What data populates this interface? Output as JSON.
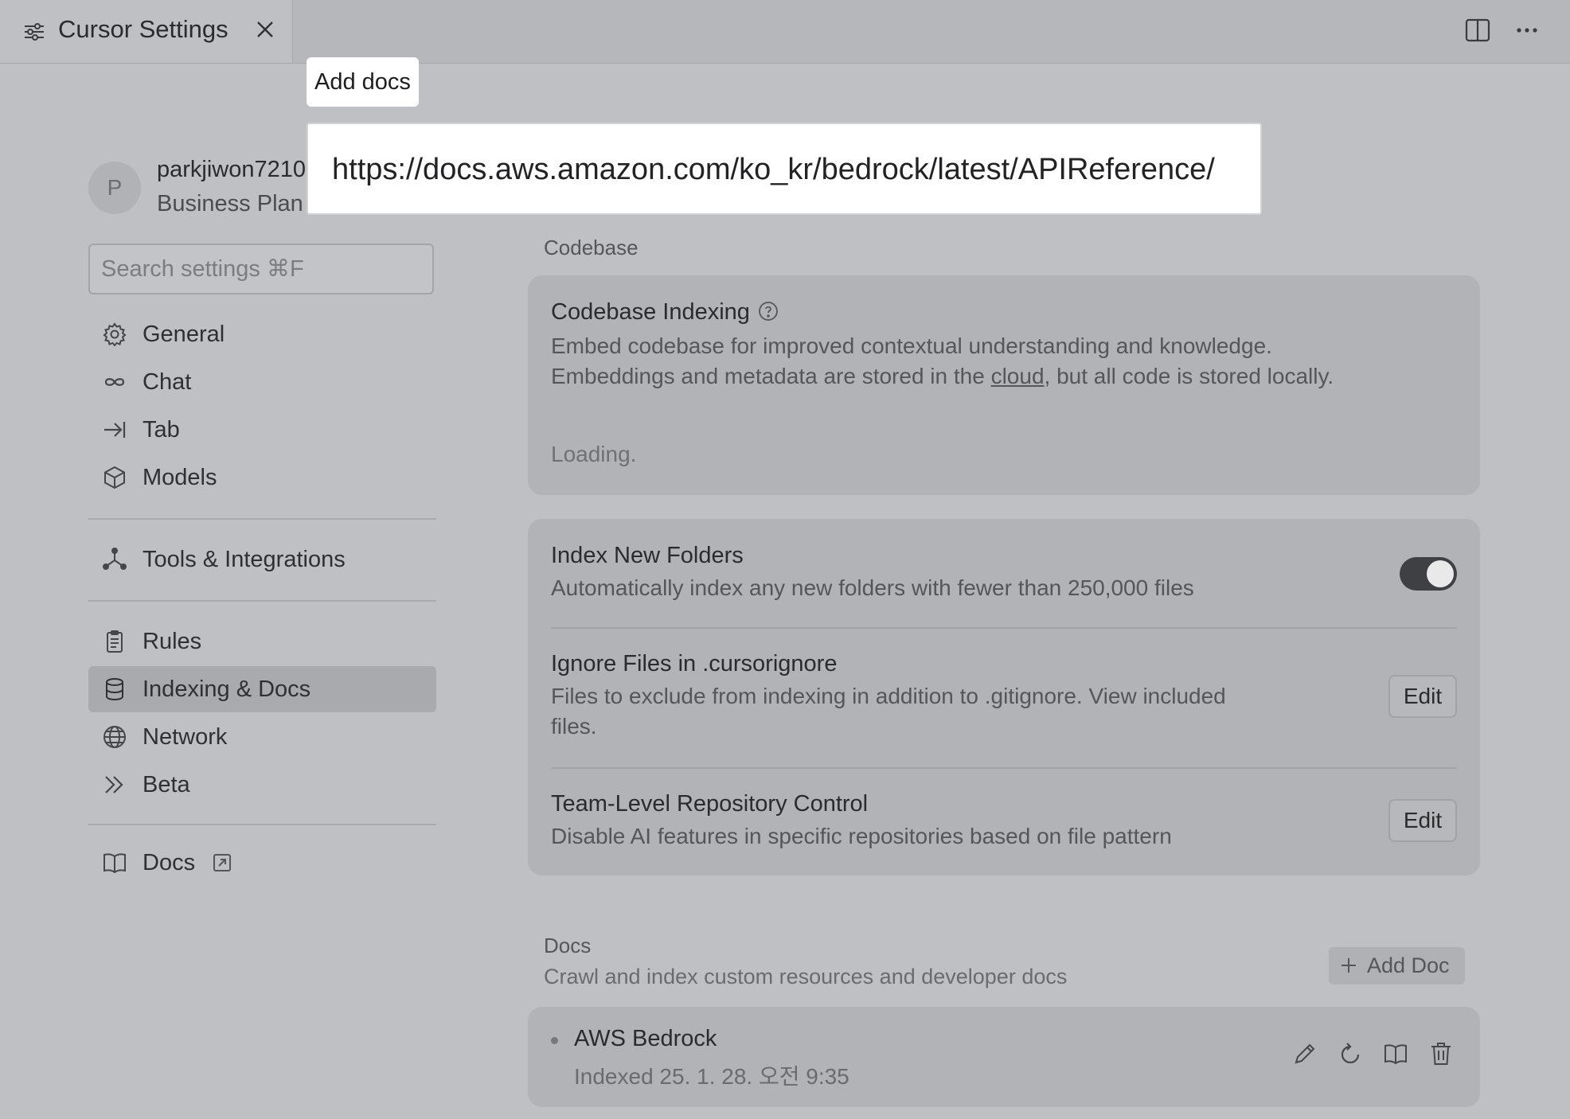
{
  "tab": {
    "title": "Cursor Settings"
  },
  "account": {
    "avatar_letter": "P",
    "username": "parkjiwon7210",
    "plan": "Business Plan"
  },
  "search": {
    "placeholder": "Search settings ⌘F"
  },
  "nav": {
    "general": "General",
    "chat": "Chat",
    "tab": "Tab",
    "models": "Models",
    "tools": "Tools & Integrations",
    "rules": "Rules",
    "indexing": "Indexing & Docs",
    "network": "Network",
    "beta": "Beta",
    "docs": "Docs"
  },
  "codebase": {
    "section_title": "Codebase",
    "indexing_title": "Codebase Indexing",
    "indexing_desc_1": "Embed codebase for improved contextual understanding and knowledge.",
    "indexing_desc_2a": "Embeddings and metadata are stored in the ",
    "indexing_desc_link": "cloud",
    "indexing_desc_2b": ", but all code is stored locally.",
    "loading": "Loading."
  },
  "settings": {
    "index_new_title": "Index New Folders",
    "index_new_desc": "Automatically index any new folders with fewer than 250,000 files",
    "index_new_enabled": true,
    "ignore_title": "Ignore Files in .cursorignore",
    "ignore_desc_1": "Files to exclude from indexing in addition to .gitignore. View included",
    "ignore_desc_2": "files.",
    "ignore_button": "Edit",
    "team_title": "Team-Level Repository Control",
    "team_desc": "Disable AI features in specific repositories based on file pattern",
    "team_button": "Edit"
  },
  "docs": {
    "section_title": "Docs",
    "section_desc": "Crawl and index custom resources and developer docs",
    "add_button": "Add Doc",
    "items": [
      {
        "name": "AWS Bedrock",
        "status": "Indexed 25. 1. 28. 오전 9:35"
      }
    ]
  },
  "add_docs_popup": {
    "label": "Add docs",
    "url_value": "https://docs.aws.amazon.com/ko_kr/bedrock/latest/APIReference/"
  }
}
